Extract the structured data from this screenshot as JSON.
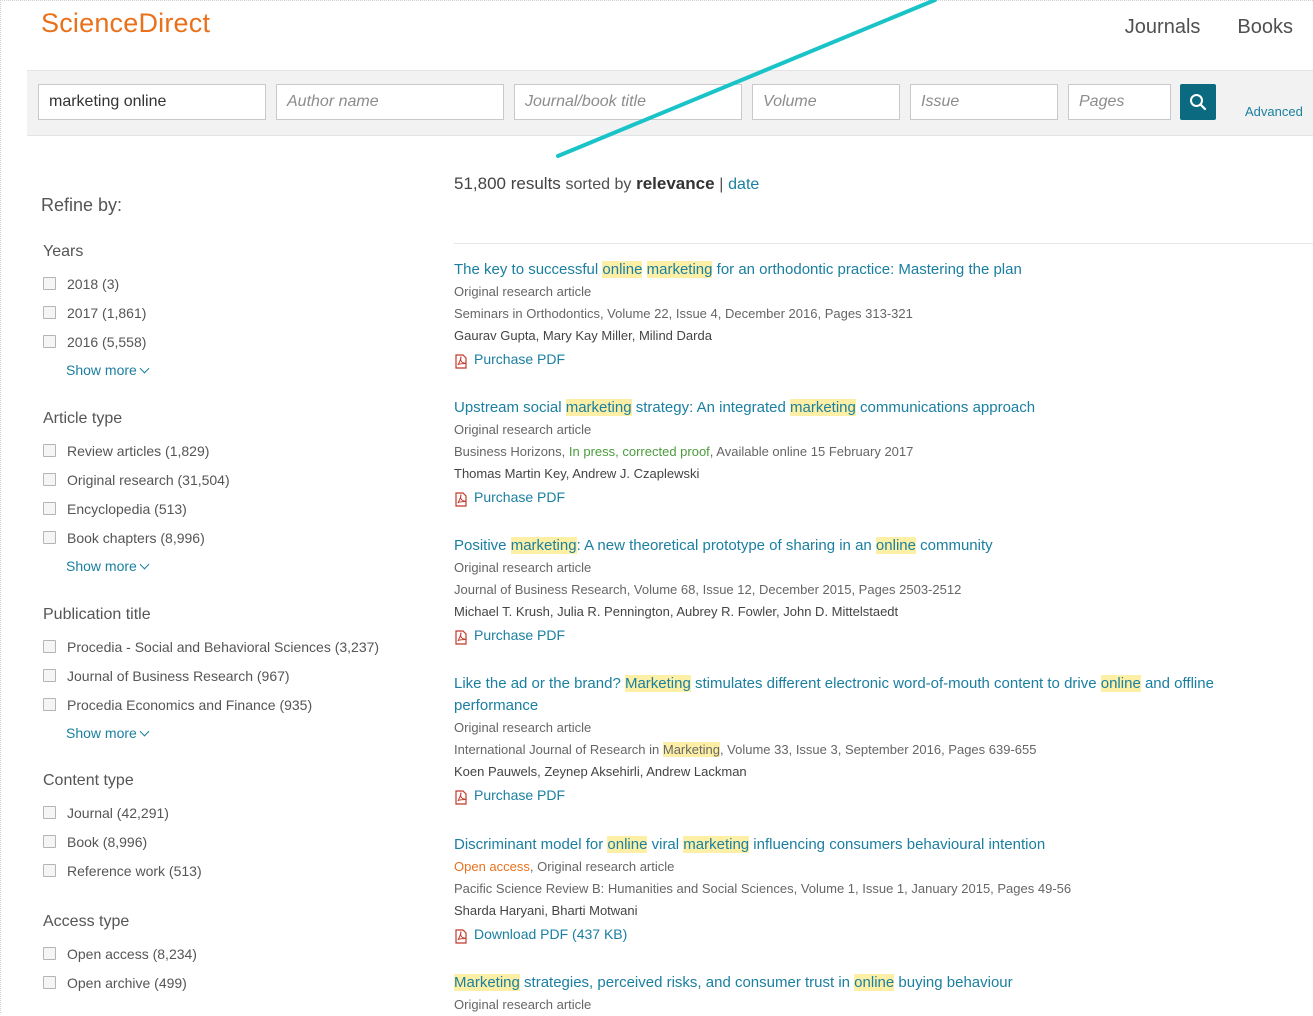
{
  "logo": "ScienceDirect",
  "topnav": {
    "journals": "Journals",
    "books": "Books"
  },
  "search": {
    "keywords_value": "marketing online",
    "author_placeholder": "Author name",
    "journal_placeholder": "Journal/book title",
    "volume_placeholder": "Volume",
    "issue_placeholder": "Issue",
    "pages_placeholder": "Pages",
    "advanced": "Advanced"
  },
  "refine": {
    "title": "Refine by:",
    "show_more": "Show more",
    "years": {
      "title": "Years",
      "items": [
        "2018 (3)",
        "2017 (1,861)",
        "2016 (5,558)"
      ]
    },
    "article_type": {
      "title": "Article type",
      "items": [
        "Review articles (1,829)",
        "Original research (31,504)",
        "Encyclopedia (513)",
        "Book chapters (8,996)"
      ]
    },
    "publication_title": {
      "title": "Publication title",
      "items": [
        "Procedia - Social and Behavioral Sciences (3,237)",
        "Journal of Business Research (967)",
        "Procedia Economics and Finance (935)"
      ]
    },
    "content_type": {
      "title": "Content type",
      "items": [
        "Journal (42,291)",
        "Book (8,996)",
        "Reference work (513)"
      ]
    },
    "access_type": {
      "title": "Access type",
      "items": [
        "Open access (8,234)",
        "Open archive (499)"
      ]
    }
  },
  "summary": {
    "count": "51,800 results",
    "sorted_by": "sorted by",
    "relevance": "relevance",
    "sep": "|",
    "date": "date"
  },
  "results": [
    {
      "title_parts": [
        "The key to successful ",
        "online",
        " ",
        "marketing",
        " for an orthodontic practice: Mastering the plan"
      ],
      "type": "Original research article",
      "source": "Seminars in Orthodontics, Volume 22, Issue 4, December 2016, Pages 313-321",
      "authors": "Gaurav Gupta, Mary Kay Miller, Milind Darda",
      "pdf": "Purchase PDF"
    },
    {
      "title_parts": [
        "Upstream social ",
        "marketing",
        " strategy: An integrated ",
        "marketing",
        " communications approach"
      ],
      "type": "Original research article",
      "source_parts": [
        "Business Horizons, ",
        "In press, corrected proof",
        ", Available online 15 February 2017"
      ],
      "authors": "Thomas Martin Key, Andrew J. Czaplewski",
      "pdf": "Purchase PDF"
    },
    {
      "title_parts": [
        "Positive ",
        "marketing",
        ": A new theoretical prototype of sharing in an ",
        "online",
        " community"
      ],
      "type": "Original research article",
      "source": "Journal of Business Research, Volume 68, Issue 12, December 2015, Pages 2503-2512",
      "authors": "Michael T. Krush, Julia R. Pennington, Aubrey R. Fowler, John D. Mittelstaedt",
      "pdf": "Purchase PDF"
    },
    {
      "title_parts": [
        "Like the ad or the brand? ",
        "Marketing",
        " stimulates different electronic word-of-mouth content to drive ",
        "online",
        " and offline performance"
      ],
      "type": "Original research article",
      "source_parts": [
        "International Journal of Research in ",
        "Marketing",
        ", Volume 33, Issue 3, September 2016, Pages 639-655"
      ],
      "authors": "Koen Pauwels, Zeynep Aksehirli, Andrew Lackman",
      "pdf": "Purchase PDF"
    },
    {
      "title_parts": [
        "Discriminant model for ",
        "online",
        " viral ",
        "marketing",
        " influencing consumers behavioural intention"
      ],
      "type_parts": [
        "Open access",
        ", Original research article"
      ],
      "source": "Pacific Science Review B: Humanities and Social Sciences, Volume 1, Issue 1, January 2015, Pages 49-56",
      "authors": "Sharda Haryani, Bharti Motwani",
      "pdf": "Download PDF (437 KB)"
    },
    {
      "title_parts": [
        "Marketing",
        " strategies, perceived risks, and consumer trust in ",
        "online",
        " buying behaviour"
      ],
      "type": "Original research article"
    }
  ],
  "colors": {
    "brand": "#e9711c",
    "link": "#1a7fa0",
    "search_button": "#0b6a80",
    "highlight": "#fdf0a6",
    "annotation_arrow": "#19c3c8"
  }
}
